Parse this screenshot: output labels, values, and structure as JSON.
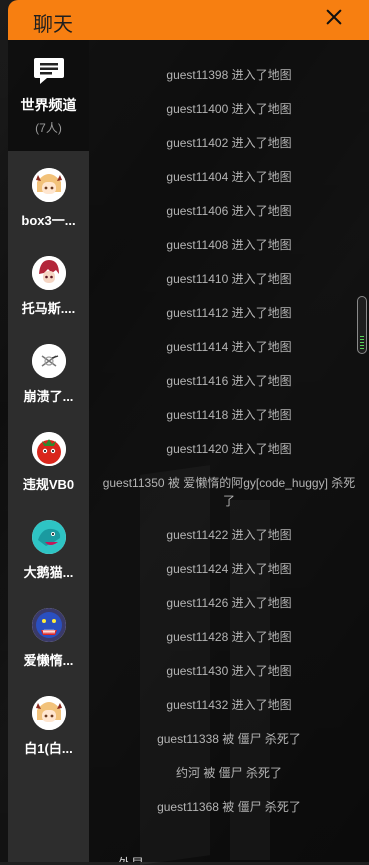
{
  "header": {
    "title": "聊天"
  },
  "world_channel": {
    "label": "世界频道",
    "count": "(7人)"
  },
  "users": [
    {
      "name": "box3一...",
      "avatar": "blonde-horned-avatar"
    },
    {
      "name": "托马斯....",
      "avatar": "redhair-avatar"
    },
    {
      "name": "崩溃了...",
      "avatar": "sketch-avatar"
    },
    {
      "name": "违规VB0",
      "avatar": "tomato-avatar"
    },
    {
      "name": "大鹅猫...",
      "avatar": "dinosaur-avatar"
    },
    {
      "name": "爱懒惰...",
      "avatar": "blue-monster-avatar"
    },
    {
      "name": "白1(白...",
      "avatar": "blonde-horned-avatar"
    }
  ],
  "messages": [
    "guest11398 进入了地图",
    "guest11400 进入了地图",
    "guest11402 进入了地图",
    "guest11404 进入了地图",
    "guest11406 进入了地图",
    "guest11408 进入了地图",
    "guest11410 进入了地图",
    "guest11412 进入了地图",
    "guest11414 进入了地图",
    "guest11416 进入了地图",
    "guest11418 进入了地图",
    "guest11420 进入了地图",
    "guest11350 被 爱懒惰的阿gy[code_huggy] 杀死了",
    "guest11422 进入了地图",
    "guest11424 进入了地图",
    "guest11426 进入了地图",
    "guest11428 进入了地图",
    "guest11430 进入了地图",
    "guest11432 进入了地图",
    "guest11338 被 僵尸 杀死了",
    "约河 被 僵尸 杀死了",
    "guest11368 被 僵尸 杀死了"
  ],
  "bottom_partial_text": "外显",
  "colors": {
    "header": "#f77f11",
    "sidebar": "#2d2d2d",
    "message_text": "#b4b4b4"
  }
}
